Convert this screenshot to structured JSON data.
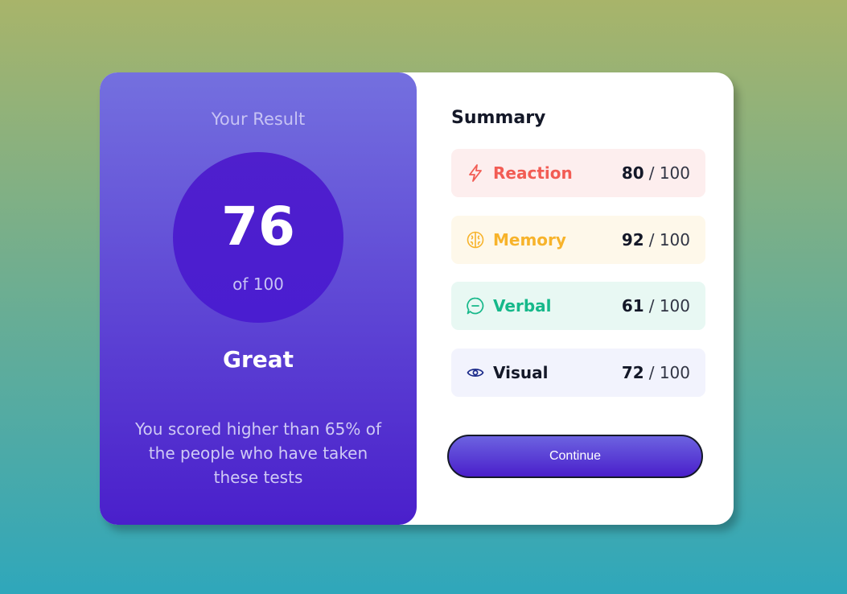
{
  "result": {
    "heading": "Your Result",
    "score": "76",
    "total": "of 100",
    "rating": "Great",
    "description": "You scored higher than 65% of the people who have taken these tests"
  },
  "summary": {
    "title": "Summary",
    "items": [
      {
        "label": "Reaction",
        "score": "80",
        "max": "/ 100",
        "icon": "lightning-icon",
        "color": "#f25c54",
        "bg": "#fdeeee"
      },
      {
        "label": "Memory",
        "score": "92",
        "max": "/ 100",
        "icon": "brain-icon",
        "color": "#f7b32b",
        "bg": "#fef8ea"
      },
      {
        "label": "Verbal",
        "score": "61",
        "max": "/ 100",
        "icon": "chat-icon",
        "color": "#16b88a",
        "bg": "#e8f8f3"
      },
      {
        "label": "Visual",
        "score": "72",
        "max": "/ 100",
        "icon": "eye-icon",
        "color": "#1b2a8a",
        "bg": "#f2f3fd"
      }
    ],
    "continue_label": "Continue"
  }
}
